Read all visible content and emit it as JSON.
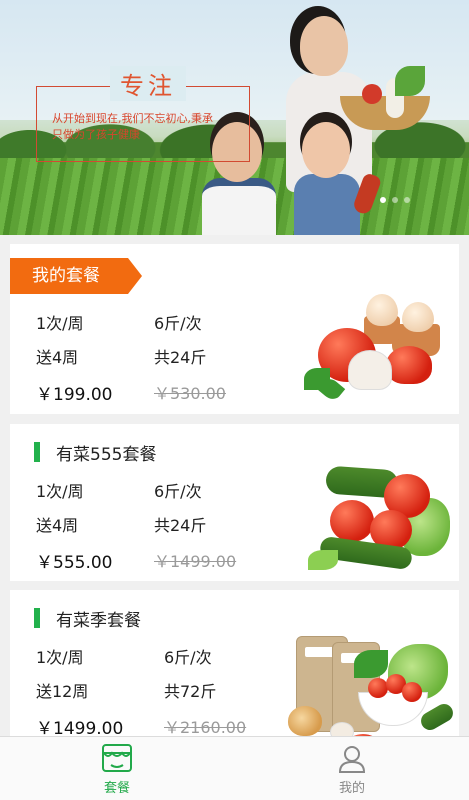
{
  "banner": {
    "title": "专注",
    "line1": "从开始到现在,我们不忘初心,秉承",
    "line2": "只做为了孩子健康"
  },
  "cards": [
    {
      "name": "我的套餐",
      "frequency": "1次/周",
      "weight": "6斤/次",
      "duration": "送4周",
      "total": "共24斤",
      "price": "￥199.00",
      "original_price": "￥530.00"
    },
    {
      "name": "有菜555套餐",
      "frequency": "1次/周",
      "weight": "6斤/次",
      "duration": "送4周",
      "total": "共24斤",
      "price": "￥555.00",
      "original_price": "￥1499.00"
    },
    {
      "name": "有菜季套餐",
      "frequency": "1次/周",
      "weight": "6斤/次",
      "duration": "送12周",
      "total": "共72斤",
      "price": "￥1499.00",
      "original_price": "￥2160.00"
    }
  ],
  "tabbar": {
    "items": [
      {
        "label": "套餐",
        "icon": "shop-icon",
        "active": true
      },
      {
        "label": "我的",
        "icon": "user-icon",
        "active": false
      }
    ],
    "active_color": "#22a94a",
    "inactive_color": "#888888"
  },
  "colors": {
    "ribbon": "#f26b10",
    "accent_bar": "#22b14c"
  }
}
